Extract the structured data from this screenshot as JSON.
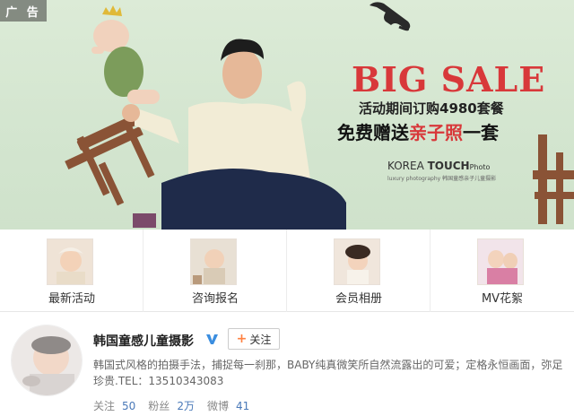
{
  "banner": {
    "ad_tag": "广 告",
    "headline": "BIG SALE",
    "promo": "活动期间订购4980套餐",
    "gift_prefix": "免费赠送",
    "gift_highlight": "亲子照",
    "gift_suffix": "一套",
    "brand_main": "KOREA ",
    "brand_bold": "TOUCH",
    "brand_tail": "Photo",
    "brand_sub": "luxury photography   韩国童感亲子儿童摄影",
    "accent_color": "#d8383a"
  },
  "nav_items": [
    {
      "label": "最新活动",
      "icon": "baby-photo-thumbnail"
    },
    {
      "label": "咨询报名",
      "icon": "baby-photo-thumbnail"
    },
    {
      "label": "会员相册",
      "icon": "baby-photo-thumbnail"
    },
    {
      "label": "MV花絮",
      "icon": "baby-photo-thumbnail"
    }
  ],
  "profile": {
    "name": "韩国童感儿童摄影",
    "verified_icon": "verified-v-icon",
    "follow_label": "关注",
    "description": "韩国式风格的拍摄手法，捕捉每一刹那，BABY纯真微笑所自然流露出的可爱；定格永恒画面，弥足珍贵.TEL：13510343083",
    "stats": {
      "following_label": "关注",
      "following_value": "50",
      "fans_label": "粉丝",
      "fans_value": "2万",
      "posts_label": "微博",
      "posts_value": "41"
    },
    "link_color": "#4a79b8"
  }
}
